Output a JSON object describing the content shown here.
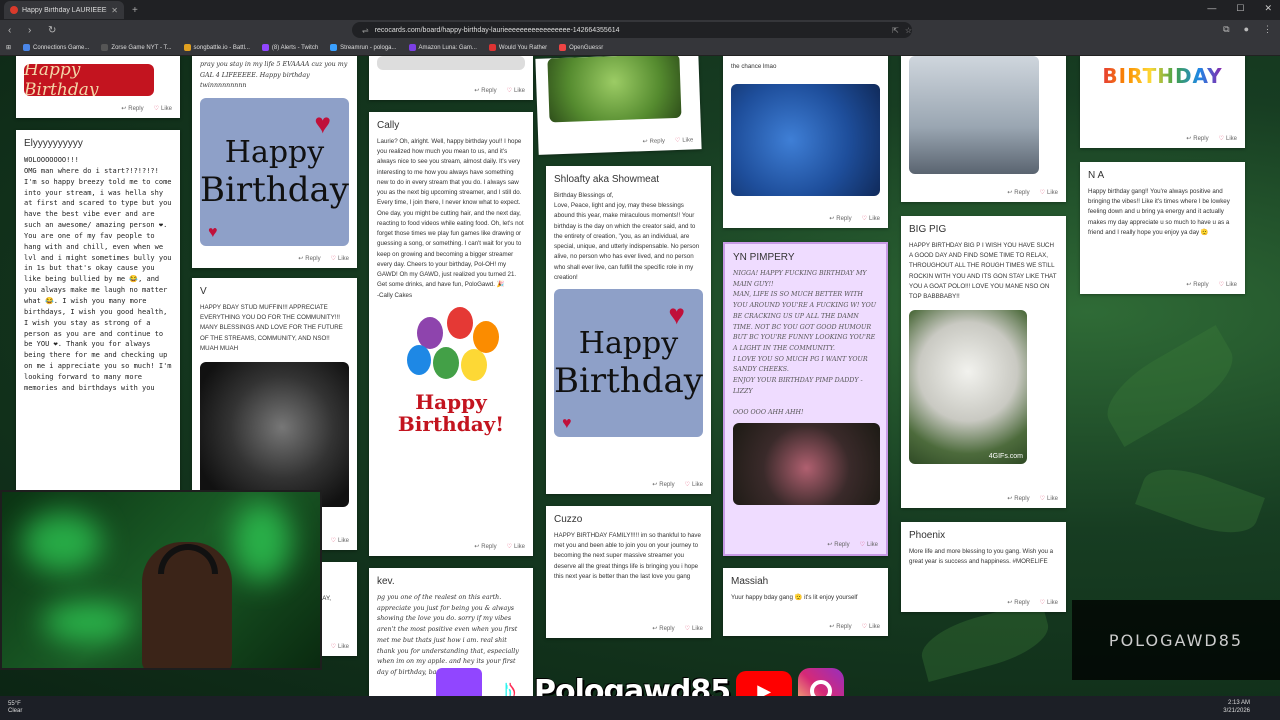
{
  "browser": {
    "tab_title": "Happy Birthday LAURIEEEEEEEEE",
    "url": "recocards.com/board/happy-birthday-laurieeeeeeeeeeeeeeeee-142664355614",
    "bookmarks": [
      "Connections Game...",
      "Zorse Game NYT - T...",
      "songbattle.io - Battl...",
      "(8) Alerts - Twitch",
      "Streamrun - pologa...",
      "Amazon Luna: Gam...",
      "Would You Rather",
      "OpenGuessr"
    ]
  },
  "actions": {
    "reply": "Reply",
    "like": "Like"
  },
  "cards": {
    "c1_top": {
      "banner": "Happy Birthday"
    },
    "elyyy": {
      "author": "Elyyyyyyyyyy",
      "message": "WOLOOOOOOO!!!\nOMG man where do i start?!?!?!?! I'm so happy breezy told me to come into your stream, i was hella shy at first and scared to type but you have the best vibe ever and are such an awesome/ amazing person ❤. You are one of my fav people to hang with and chill, even when we lvl and i might sometimes bully you in 1s but that's okay cause you like being bullied by me 😂, and you always make me laugh no matter what 😂. I wish you many more birthdays, I wish you good health, I wish you stay as strong of a person as you are and continue to be YOU ❤. Thank you for always being there for me and checking up on me i appreciate you so much! I'm looking forward to many more memories and birthdays with you"
    },
    "c2_top": {
      "message": "pray you stay in my life 5 EVAAAA cuz you my GAL 4 LIFEEEEE. Happy birthday twinnnnnnnnn"
    },
    "v": {
      "author": "V",
      "message": "HAPPY BDAY STUD MUFFIN!!! APPRECIATE EVERYTHING YOU DO FOR THE COMMUNITY!!! MANY BLESSINGS AND LOVE FOR THE FUTURE OF THE STREAMS, COMMUNITY, AND NSO!! MUAH MUAH"
    },
    "c2_bottom": {
      "message": "AY,"
    },
    "cally": {
      "author": "Cally",
      "message": "Laurie? Oh, alright. Well, happy birthday you!! I hope you realized how much you mean to us, and it's always nice to see you stream, almost daily. It's very interesting to me how you always have something new to do in every stream that you do. I always saw you as the next big upcoming streamer, and I still do. Every time, I join there, I never know what to expect. One day, you might be cutting hair, and the next day, reacting to food videos while eating food. Oh, let's not forget those times we play fun games like drawing or guessing a song, or something. I can't wait for you to keep on growing and becoming a bigger streamer every day. Cheers to your birthday, Pol-OH! my GAWD! Oh my GAWD, just realized you turned 21. Get some drinks, and have fun, PoloGawd. 🎉\n-Cally Cakes"
    },
    "kev": {
      "author": "kev.",
      "message": "pg you one of the realest on this earth. appreciate you just for being you & always showing the love you do. sorry if my vibes aren't the most positive even when you first met me but thats just how i am. real shit thank you for understanding that, especially when im on my apple. and hey its your first day of birthday, back to it"
    },
    "shloafty": {
      "author": "Shloafty aka Showmeat",
      "message": "Birthday Blessings of,\nLove, Peace, light and joy, may these blessings abound this year, make miraculous moments!! Your birthday is the day on which the creator said, and to the entirety of creation, \"you, as an individual, are special, unique, and utterly indispensable. No person alive, no person who has ever lived, and no person who shall ever live, can fulfill the specific role in my creation!"
    },
    "cuzzo": {
      "author": "Cuzzo",
      "message": "HAPPY BIRTHDAY FAMILY!!!!! im so thankful to have met you and been able to join you on your journey to becoming the next super massive streamer you deserve all the great things life is bringing you i hope this next year is better than the last love you gang"
    },
    "c5_top": {
      "message": "the chance lmao"
    },
    "yn": {
      "author": "YN PIMPERY",
      "message": "NIGGA! HAPPY FUCKING BIRTHDAY MY MAIN guy!!\nMAN, LIFE IS SO MUCH BETTER WITH YOU AROUND YOU'RE A FUCKING W! YOU BE CRACKING US UP ALL THE DAMN TIME. NOT BC YOU GOT GOOD HUMOUR BUT BC YOU'RE FUNNY LOOKING YOU'RE A LIGHT IN THE COMMUNITY.\nI LOVE YOU SO MUCH PG I WANT YOUR SANDY CHEEKS.\nENJOY YOUR BIRTHDAY PIMP DADDY - Lizzy\n\nOOO OOO AHH AHH!"
    },
    "massiah": {
      "author": "Massiah",
      "message": "Yuur happy bday gang 🫡 it's lit enjoy yourself"
    },
    "bigpig": {
      "author": "BIG PIG",
      "message": "HAPPY BIRTHDAY BIG P I WISH YOU HAVE SUCH A GOOD DAY AND FIND SOME TIME TO RELAX, THROUGHOUT ALL THE ROUGH TIMES WE STILL ROCKIN WITH YOU AND ITS GON STAY LIKE THAT YOU A GOAT POLO!!! LOVE YOU MANE NSO ON TOP BABBBABY!!",
      "gif_tag": "4GIFs.com"
    },
    "phoenix": {
      "author": "Phoenix",
      "message": "More life and more blessing to you gang. Wish you a great year is success and happiness. #MORELIFE"
    },
    "c7_top": {
      "banner": "BIRTHDAY"
    },
    "na": {
      "author": "N A",
      "message": "Happy birthday gang!! You're always positive and bringing the vibes!! Like it's times where I be lowkey feeling down and u bring ya energy and it actually makes my day appreciate u so much to have u as a friend and I really hope you enjoy ya day 🫡"
    }
  },
  "images": {
    "hb_line1": "Happy",
    "hb_line2": "Birthday",
    "balloon_line1": "Happy",
    "balloon_line2": "Birthday!"
  },
  "overlay": {
    "watermark": "POLOGAWD85",
    "social_name": "Pologawd85"
  },
  "taskbar": {
    "temp": "55°F",
    "weather": "Clear",
    "time": "2:13 AM",
    "date": "3/21/2026"
  },
  "colors": {
    "accent_red": "#c3141f",
    "hb_blue": "#8ea0c8",
    "purple_card": "#efdcff",
    "twitch": "#9146ff"
  }
}
